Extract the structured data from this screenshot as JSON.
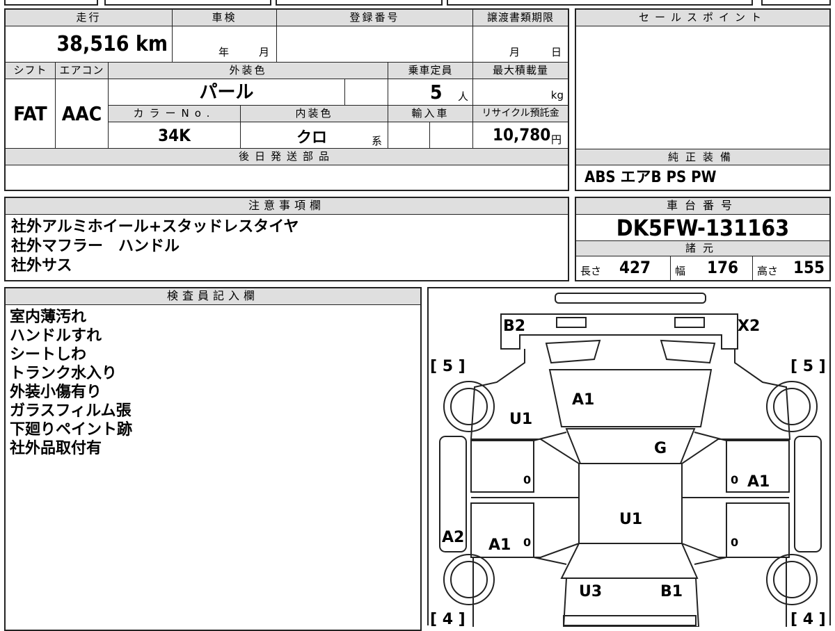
{
  "header": {
    "mileage_label": "走行",
    "inspection_label": "車検",
    "registration_label": "登録番号",
    "transfer_deadline_label": "譲渡書類期限",
    "sales_point_label": "セールスポイント"
  },
  "values": {
    "mileage": "38,516 km",
    "inspection_year": "年",
    "inspection_month": "月",
    "transfer_month": "月",
    "transfer_day": "日"
  },
  "row2": {
    "shift_label": "シフト",
    "aircon_label": "エアコン",
    "exterior_color_label": "外装色",
    "capacity_label": "乗車定員",
    "max_load_label": "最大積載量",
    "shift": "FAT",
    "aircon": "AAC",
    "exterior_color": "パール",
    "capacity": "5",
    "capacity_unit": "人",
    "load_unit": "kg",
    "color_no_label": "カラーNo.",
    "interior_color_label": "内装色",
    "import_label": "輸入車",
    "recycle_label": "リサイクル預託金",
    "color_no": "34K",
    "interior_color": "クロ",
    "interior_suffix": "系",
    "recycle_fee": "10,780",
    "recycle_unit": "円"
  },
  "later_parts_label": "後日発送部品",
  "standard_equipment": {
    "label": "純正装備",
    "value": "ABS エアB PS PW"
  },
  "notes": {
    "label": "注意事項欄",
    "lines": [
      "社外アルミホイール+スタッドレスタイヤ",
      "社外マフラー　ハンドル",
      "社外サス"
    ]
  },
  "chassis": {
    "label": "車台番号",
    "number": "DK5FW-131163",
    "specs_label": "諸元",
    "length_label": "長さ",
    "length": "427",
    "width_label": "幅",
    "width": "176",
    "height_label": "高さ",
    "height": "155"
  },
  "inspector": {
    "label": "検査員記入欄",
    "lines": [
      "室内薄汚れ",
      "ハンドルすれ",
      "シートしわ",
      "トランク水入り",
      "外装小傷有り",
      "ガラスフィルム張",
      "下廻りペイント跡",
      "社外品取付有"
    ]
  },
  "diagram": {
    "tread_fl": "[ 5 ]",
    "tread_fr": "[ 5 ]",
    "tread_rl": "[ 4 ]",
    "tread_rr": "[ 4 ]",
    "marks": {
      "b2": "B2",
      "x2": "X2",
      "a1_windshield": "A1",
      "u1_front_left": "U1",
      "g_roof_front": "G",
      "a1_right_door": "A1",
      "u1_roof": "U1",
      "a2_left_sill": "A2",
      "a1_left_rear": "A1",
      "u3": "U3",
      "b1": "B1",
      "zero_a": "0",
      "zero_b": "0",
      "zero_c": "0",
      "zero_d": "0"
    }
  }
}
